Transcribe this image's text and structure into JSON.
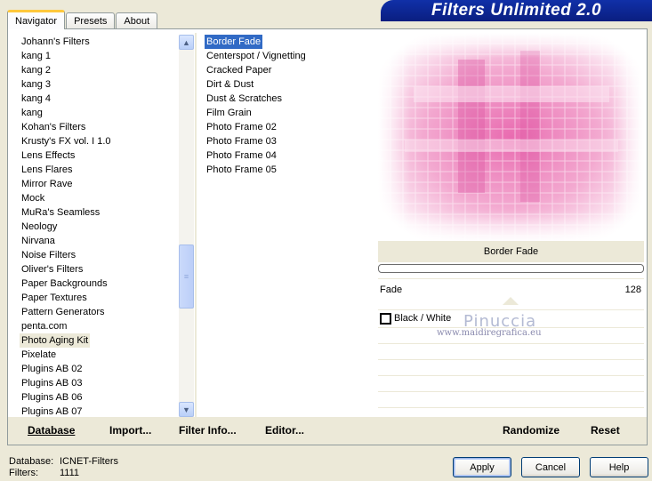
{
  "tabs": [
    {
      "label": "Navigator"
    },
    {
      "label": "Presets"
    },
    {
      "label": "About"
    }
  ],
  "banner": {
    "title": "Filters Unlimited 2.0"
  },
  "categories": [
    "Johann's Filters",
    "kang 1",
    "kang 2",
    "kang 3",
    "kang 4",
    "kang",
    "Kohan's Filters",
    "Krusty's FX vol. I 1.0",
    "Lens Effects",
    "Lens Flares",
    "Mirror Rave",
    "Mock",
    "MuRa's Seamless",
    "Neology",
    "Nirvana",
    "Noise Filters",
    "Oliver's Filters",
    "Paper Backgrounds",
    "Paper Textures",
    "Pattern Generators",
    "penta.com",
    "Photo Aging Kit",
    "Pixelate",
    "Plugins AB 02",
    "Plugins AB 03",
    "Plugins AB 06",
    "Plugins AB 07"
  ],
  "selected_category": "Photo Aging Kit",
  "filters": [
    "Border Fade",
    "Centerspot / Vignetting",
    "Cracked Paper",
    "Dirt & Dust",
    "Dust & Scratches",
    "Film Grain",
    "Photo Frame 02",
    "Photo Frame 03",
    "Photo Frame 04",
    "Photo Frame 05"
  ],
  "selected_filter": "Border Fade",
  "params": {
    "filter_title": "Border Fade",
    "fade_label": "Fade",
    "fade_value": "128",
    "checkbox_label": "Black / White",
    "checkbox_checked": false
  },
  "watermark": {
    "name": "Pinuccia",
    "url": "www.maidiregrafica.eu"
  },
  "panel_buttons": {
    "database": "Database",
    "import": "Import...",
    "filter_info": "Filter Info...",
    "editor": "Editor...",
    "randomize": "Randomize",
    "reset": "Reset"
  },
  "footer": {
    "database_label": "Database:",
    "database_value": "ICNET-Filters",
    "filters_label": "Filters:",
    "filters_value": "1111"
  },
  "dialog_buttons": {
    "apply": "Apply",
    "cancel": "Cancel",
    "help": "Help"
  },
  "colors": {
    "selection": "#316AC5",
    "banner": "#0A1E80",
    "preview_pink": "#F2A6CF"
  }
}
